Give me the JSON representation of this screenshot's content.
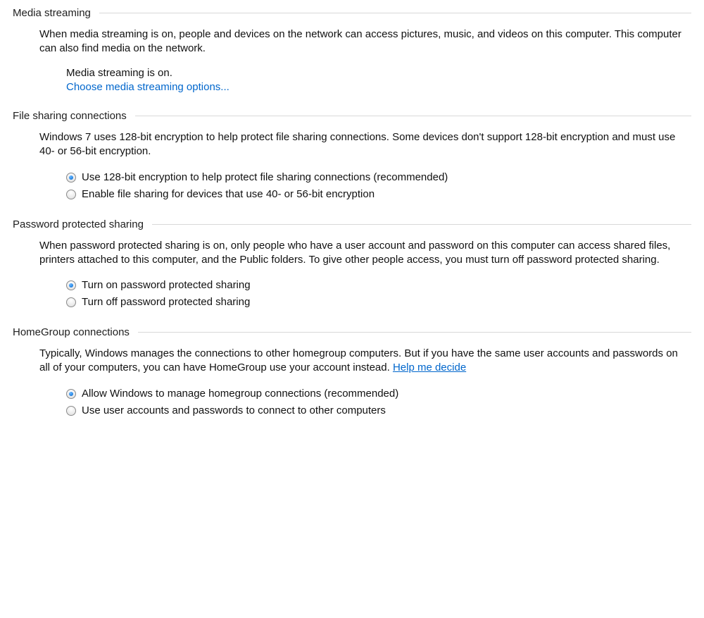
{
  "sections": {
    "media": {
      "title": "Media streaming",
      "description": "When media streaming is on, people and devices on the network can access pictures, music, and videos on this computer. This computer can also find media on the network.",
      "status": "Media streaming is on.",
      "link": "Choose media streaming options..."
    },
    "fileSharing": {
      "title": "File sharing connections",
      "description": "Windows 7 uses 128-bit encryption to help protect file sharing connections. Some devices don't support 128-bit encryption and must use 40- or 56-bit encryption.",
      "options": [
        {
          "label": "Use 128-bit encryption to help protect file sharing connections (recommended)",
          "selected": true
        },
        {
          "label": "Enable file sharing for devices that use 40- or 56-bit encryption",
          "selected": false
        }
      ]
    },
    "password": {
      "title": "Password protected sharing",
      "description": "When password protected sharing is on, only people who have a user account and password on this computer can access shared files, printers attached to this computer, and the Public folders. To give other people access, you must turn off password protected sharing.",
      "options": [
        {
          "label": "Turn on password protected sharing",
          "selected": true
        },
        {
          "label": "Turn off password protected sharing",
          "selected": false
        }
      ]
    },
    "homegroup": {
      "title": "HomeGroup connections",
      "descriptionPrefix": "Typically, Windows manages the connections to other homegroup computers. But if you have the same user accounts and passwords on all of your computers, you can have HomeGroup use your account instead. ",
      "helpLink": "Help me decide",
      "options": [
        {
          "label": "Allow Windows to manage homegroup connections (recommended)",
          "selected": true
        },
        {
          "label": "Use user accounts and passwords to connect to other computers",
          "selected": false
        }
      ]
    }
  }
}
